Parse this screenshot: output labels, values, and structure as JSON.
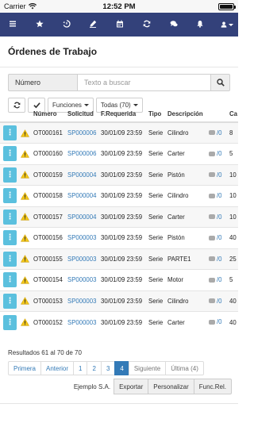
{
  "status_bar": {
    "carrier": "Carrier",
    "time": "12:52 PM",
    "battery_level": 1.0
  },
  "navbar": {
    "icons": [
      "menu-icon",
      "star-icon",
      "history-icon",
      "pen-icon",
      "calendar-icon",
      "refresh-icon",
      "chat-icon",
      "bell-icon",
      "user-icon"
    ]
  },
  "page": {
    "title": "Órdenes de Trabajo"
  },
  "search": {
    "field": "Número",
    "placeholder": "Texto a buscar"
  },
  "toolbar": {
    "functions_label": "Funciones",
    "filter_label": "Todas (70)"
  },
  "table": {
    "columns": [
      "",
      "",
      "Número",
      "Solicitud",
      "F.Requerida",
      "Tipo",
      "Descripción",
      "",
      "Ca"
    ],
    "rows": [
      {
        "numero": "OT000161",
        "solicitud": "SP000006",
        "fecha": "30/01/09 23:59",
        "tipo": "Serie",
        "descripcion": "Cilindro",
        "comments": "/0",
        "cant": "8"
      },
      {
        "numero": "OT000160",
        "solicitud": "SP000006",
        "fecha": "30/01/09 23:59",
        "tipo": "Serie",
        "descripcion": "Carter",
        "comments": "/0",
        "cant": "5"
      },
      {
        "numero": "OT000159",
        "solicitud": "SP000004",
        "fecha": "30/01/09 23:59",
        "tipo": "Serie",
        "descripcion": "Pistón",
        "comments": "/0",
        "cant": "10"
      },
      {
        "numero": "OT000158",
        "solicitud": "SP000004",
        "fecha": "30/01/09 23:59",
        "tipo": "Serie",
        "descripcion": "Cilindro",
        "comments": "/0",
        "cant": "10"
      },
      {
        "numero": "OT000157",
        "solicitud": "SP000004",
        "fecha": "30/01/09 23:59",
        "tipo": "Serie",
        "descripcion": "Carter",
        "comments": "/0",
        "cant": "10"
      },
      {
        "numero": "OT000156",
        "solicitud": "SP000003",
        "fecha": "30/01/09 23:59",
        "tipo": "Serie",
        "descripcion": "Pistón",
        "comments": "/0",
        "cant": "40"
      },
      {
        "numero": "OT000155",
        "solicitud": "SP000003",
        "fecha": "30/01/09 23:59",
        "tipo": "Serie",
        "descripcion": "PARTE1",
        "comments": "/0",
        "cant": "25"
      },
      {
        "numero": "OT000154",
        "solicitud": "SP000003",
        "fecha": "30/01/09 23:59",
        "tipo": "Serie",
        "descripcion": "Motor",
        "comments": "/0",
        "cant": "5"
      },
      {
        "numero": "OT000153",
        "solicitud": "SP000003",
        "fecha": "30/01/09 23:59",
        "tipo": "Serie",
        "descripcion": "Cilindro",
        "comments": "/0",
        "cant": "40"
      },
      {
        "numero": "OT000152",
        "solicitud": "SP000003",
        "fecha": "30/01/09 23:59",
        "tipo": "Serie",
        "descripcion": "Carter",
        "comments": "/0",
        "cant": "40"
      }
    ]
  },
  "results": {
    "text": "Resultados 61 al 70 de 70"
  },
  "pagination": {
    "first": "Primera",
    "prev": "Anterior",
    "pages": [
      "1",
      "2",
      "3",
      "4"
    ],
    "active_page": "4",
    "next": "Siguiente",
    "last": "Última (4)"
  },
  "footer": {
    "company": "Ejemplo S.A.",
    "export": "Exportar",
    "customize": "Personalizar",
    "func_rel": "Func.Rel."
  },
  "colors": {
    "navbar": "#33417a",
    "accent": "#337ab7",
    "action_button": "#5bc0de",
    "warning": "#f0c419"
  }
}
